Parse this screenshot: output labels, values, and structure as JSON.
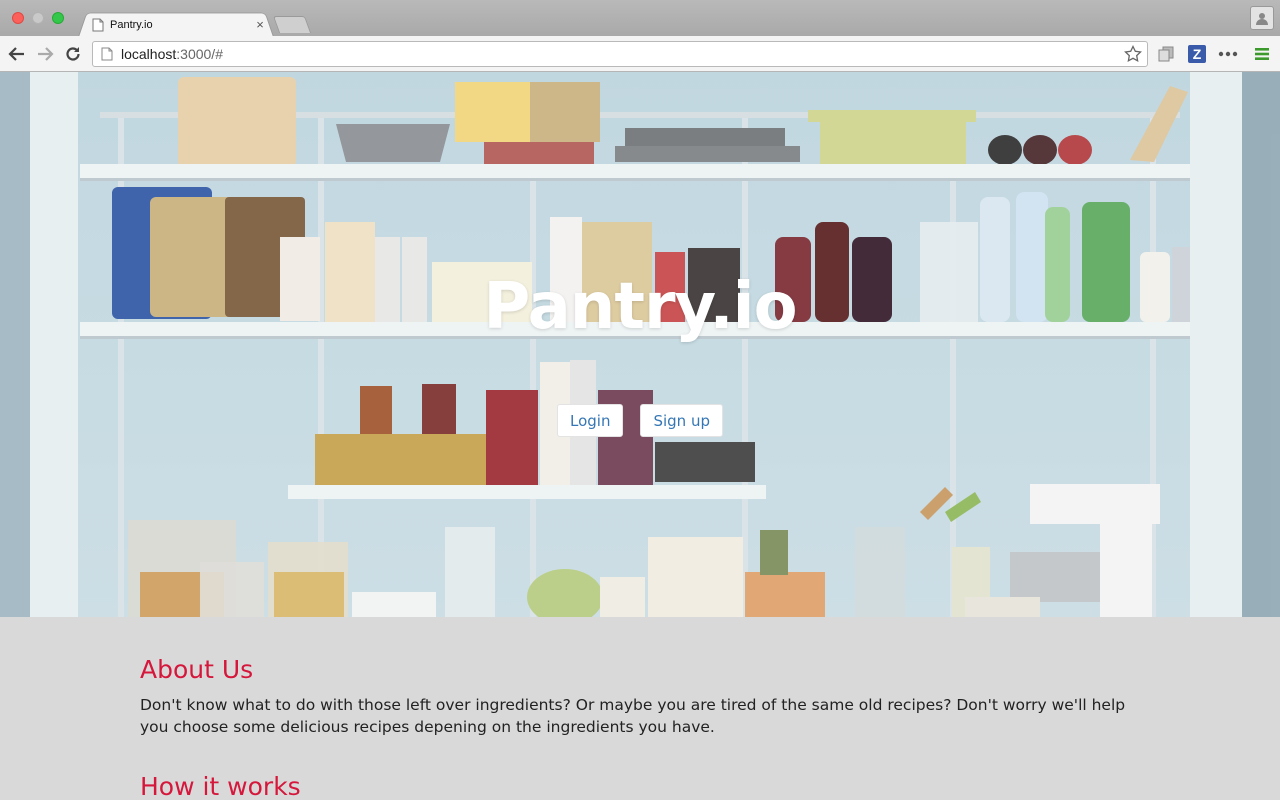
{
  "browser": {
    "tab_title": "Pantry.io",
    "tab_close": "×",
    "url_host": "localhost",
    "url_rest": ":3000/#",
    "extension_z": "Z"
  },
  "hero": {
    "title": "Pantry.io",
    "login_label": "Login",
    "signup_label": "Sign up"
  },
  "about": {
    "title": "About Us",
    "text": "Don't know what to do with those left over ingredients? Or maybe you are tired of the same old recipes? Don't worry we'll help you choose some delicious recipes depening on the ingredients you have."
  },
  "how": {
    "title": "How it works"
  },
  "colors": {
    "accent": "#d6173c",
    "button_text": "#3577b5"
  }
}
